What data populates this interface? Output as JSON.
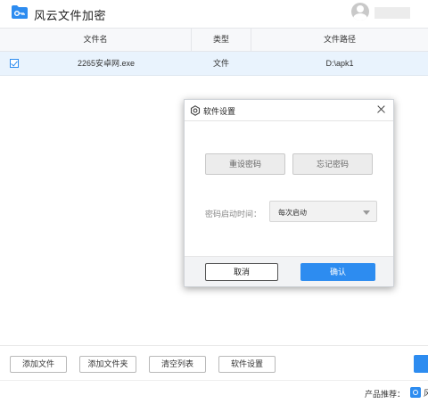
{
  "app": {
    "title": "风云文件加密",
    "accent_color": "#2d8cf0",
    "icon": "folder-key-icon"
  },
  "table": {
    "columns": [
      "文件名",
      "类型",
      "文件路径"
    ],
    "rows": [
      {
        "checked": true,
        "name": "2265安卓网.exe",
        "type": "文件",
        "path": "D:\\apk1"
      }
    ]
  },
  "toolbar": {
    "add_file": "添加文件",
    "add_folder": "添加文件夹",
    "clear_list": "清空列表",
    "settings": "软件设置"
  },
  "footer": {
    "recommend_label": "产品推荐：",
    "recommend_edge_text": "风"
  },
  "dialog": {
    "title": "软件设置",
    "reset_password": "重设密码",
    "forgot_password": "忘记密码",
    "startup_label": "密码启动时间：",
    "startup_value": "每次启动",
    "cancel": "取消",
    "confirm": "确认"
  }
}
